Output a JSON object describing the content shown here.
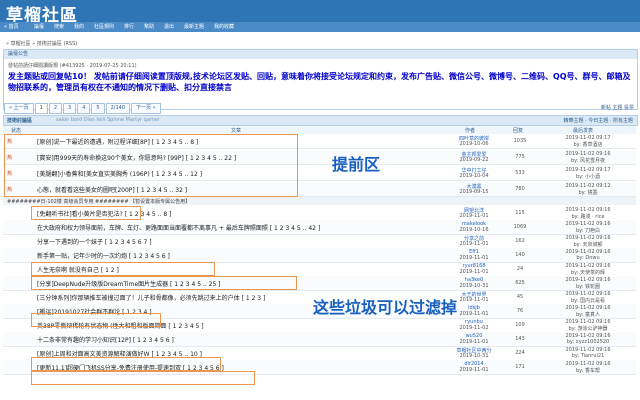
{
  "header": {
    "title": "草榴社區"
  },
  "nav": {
    "items": [
      "« 首頁",
      "論壇",
      "搜索",
      "我的",
      "社區規則",
      "排行",
      "幫助",
      "退出",
      "最新主題",
      "我的收藏"
    ]
  },
  "breadcrumb": "» 草榴社區 » 技術討論區 (RSS)",
  "notice": {
    "bar": "論壇公告",
    "sub": "發帖前請仔細閱讀版規 (#413925 · 2019-07-25 20:11)",
    "text": "发主题贴或回复帖10！ 发帖前请仔细阅读置顶版规,技术论坛区发贴、回贴，意味着你将接受论坛规定和约束，发布广告贴、微信公号、微博号、二维码、QQ号、群号、邮箱及物招联系的，管理员有权在不通知的情况下删贴、扣分直接禁言"
  },
  "pager": {
    "items": [
      "« 上一页",
      "1",
      "2",
      "3",
      "4",
      "5",
      "2/140",
      "下一页 »"
    ],
    "current": "1",
    "right": "新帖 主题 投票"
  },
  "forum": {
    "title": "技術討論區",
    "subtitle": "salon bord Dies feili Spinne Martyr qamer",
    "tools": "精華主題 · 今日主題 · 所有主題"
  },
  "columns": {
    "status": "状态",
    "title": "文章",
    "author": "作者",
    "replies": "回复",
    "last": "最后发表"
  },
  "rows": [
    {
      "status": "热",
      "title": "[原创]说一下最近的遭遇，附过程详细[8P] [ 1 2 3 4 5 .. 8 ]",
      "author": "四叶草的彼岸",
      "date": "2019-10-06",
      "replies": "1035",
      "last_time": "2019-11-02 09:17",
      "last_by": "by: 香草酒店"
    },
    {
      "status": "热",
      "title": "[寳安]用999天的寿命换这90个美女，你愿意吗? [99P] [ 1 2 3 4 5 .. 22 ]",
      "author": "金主邦爱爱",
      "date": "2019-09-22",
      "replies": "775",
      "last_time": "2019-11-02 09:16",
      "last_by": "by: 风花雪月夜"
    },
    {
      "status": "热",
      "title": "[美腿翻]小香蕉和[美女直实美胸秀 (196P) [ 1 2 3 4 5 .. 12 ]",
      "author": "华中打工仔",
      "date": "2019-10-04",
      "replies": "533",
      "last_time": "2019-11-02 09:17",
      "last_by": "by: 小小酒"
    },
    {
      "status": "热",
      "title": "心態，就看看这些美女的圖吧[200P] [ 1 2 3 4 5 .. 32 ]",
      "author": "大漠黑",
      "date": "2019-09-15",
      "replies": "780",
      "last_time": "2019-11-02 09:12",
      "last_by": "by: 镜墨"
    },
    {
      "status": "",
      "title": "[免翻听书社]看小黄片是否犯法? [ 1 2 3 4 5 .. 8 ]",
      "author": "网望北洋",
      "date": "2019-11-01",
      "replies": "115",
      "last_time": "2019-11-02 09:16",
      "last_by": "by: 路漫 · rice"
    },
    {
      "status": "",
      "title": "在大政府和权力领导面前，车牌、车灯、更路面面当面覆都不离事凡 + 最后车牌照面照 [ 1 2 3 4 5 .. 42 ]",
      "author": "makelook",
      "date": "2019-10-16",
      "replies": "1069",
      "last_time": "2019-11-02 09:16",
      "last_by": "by: 刀疤白"
    },
    {
      "status": "",
      "title": "分享一下遇到的一个妹子 [ 1 2 3 4 5 6 7 ]",
      "author": "分享之前",
      "date": "2019-11-01",
      "replies": "162",
      "last_time": "2019-11-02 09:16",
      "last_by": "by: 天京城郁"
    },
    {
      "status": "",
      "title": "新手第一贴，记年少时的一次约炮 [ 1 2 3 4 5 6 ]",
      "author": "Eff1",
      "date": "2019-11-01",
      "replies": "140",
      "last_time": "2019-11-02 09:16",
      "last_by": "by: Dnwu"
    },
    {
      "status": "",
      "title": "人生无奈啊 就没有自己 [ 1 2 ]",
      "author": "ryur8168",
      "date": "2019-11-01",
      "replies": "24",
      "last_time": "2019-11-02 09:16",
      "last_by": "by: 天使茶的辉"
    },
    {
      "status": "",
      "title": "[分享]DeepNude升级版DreamTime图片生成器 [ 1 2 3 4 5 .. 25 ]",
      "author": "ha3ke0",
      "date": "2019-10-31",
      "replies": "625",
      "last_time": "2019-11-02 09:16",
      "last_by": "by: 铁轮圈"
    },
    {
      "status": "",
      "title": "[三分钟系列]你那辆推车被撞过面了！儿子和骨都像，必须先跳过来上的户体 [ 1 2 3 ]",
      "author": "大王的世界",
      "date": "2019-11-01",
      "replies": "45",
      "last_time": "2019-11-02 09:16",
      "last_by": "by: 国内云是看"
    },
    {
      "status": "",
      "title": "[搬运]20191027社会群不群论 [ 1 2 3 4 ]",
      "author": "ldsjb",
      "date": "2019-11-01",
      "replies": "76",
      "last_time": "2019-11-02 09:16",
      "last_by": "by: 童真人"
    },
    {
      "status": "",
      "title": "英38P零撕辩稀轮有状态物 (性大和粗和版面简面 [ 1 2 3 4 5 ]",
      "author": "ryunbu",
      "date": "2019-11-02",
      "replies": "109",
      "last_time": "2019-11-02 09:16",
      "last_by": "by: 游泳公驴神器"
    },
    {
      "status": "",
      "title": "十二条非常有趣的学习小知识[12P] [ 1 2 3 4 5 6 ]",
      "author": "wu520",
      "date": "2019-11-01",
      "replies": "143",
      "last_time": "2019-11-02 09:16",
      "last_by": "by: xyzz1002520"
    },
    {
      "status": "",
      "title": "[原创]上周和对面高文美资源解释演做好W [ 1 2 3 4 5 .. 10 ]",
      "author": "草榴社区中两分",
      "date": "2019-10-31",
      "replies": "224",
      "last_time": "2019-11-02 09:16",
      "last_by": "by: Tianrui21"
    },
    {
      "status": "",
      "title": "[更新11.1]超硬门飞机SS分享-免费注册使用-提速到双 [ 1 2 3 4 5 6 ]",
      "author": "dlr2014",
      "date": "2019-11-01",
      "replies": "171",
      "last_time": "2019-11-02 09:16",
      "last_by": "by: 香车帮"
    }
  ],
  "separator": "########日-102楼 高级会员专用 ######## 【暂设置本版专属公告用】",
  "annotations": {
    "top": "提前区",
    "middle": "这些垃圾可以过滤掉"
  },
  "colors": {
    "header": "#2f74b5",
    "hot": "#dd3300",
    "notice": "#0000cc",
    "callout": "#e8974d",
    "annotation": "#1860c0"
  }
}
